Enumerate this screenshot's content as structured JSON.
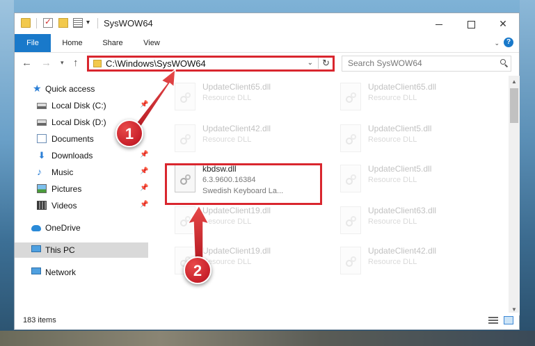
{
  "window": {
    "title": "SysWOW64"
  },
  "ribbon": {
    "tabs": [
      "File",
      "Home",
      "Share",
      "View"
    ]
  },
  "address": {
    "path": "C:\\Windows\\SysWOW64"
  },
  "search": {
    "placeholder": "Search SysWOW64"
  },
  "sidebar": {
    "items": [
      {
        "label": "Quick access",
        "icon": "star-icon"
      },
      {
        "label": "Local Disk (C:)",
        "icon": "drive-icon",
        "pinned": true
      },
      {
        "label": "Local Disk (D:)",
        "icon": "drive-icon",
        "pinned": false
      },
      {
        "label": "Documents",
        "icon": "documents-icon",
        "pinned": false
      },
      {
        "label": "Downloads",
        "icon": "download-icon",
        "pinned": true
      },
      {
        "label": "Music",
        "icon": "music-icon",
        "pinned": true
      },
      {
        "label": "Pictures",
        "icon": "pictures-icon",
        "pinned": true
      },
      {
        "label": "Videos",
        "icon": "videos-icon",
        "pinned": true
      },
      {
        "label": "OneDrive",
        "icon": "cloud-icon"
      },
      {
        "label": "This PC",
        "icon": "computer-icon",
        "selected": true
      },
      {
        "label": "Network",
        "icon": "network-icon"
      }
    ]
  },
  "files": [
    {
      "name": "UpdateClient65.dll",
      "type": "Resource DLL",
      "faded": true
    },
    {
      "name": "UpdateClient65.dll",
      "type": "Resource DLL",
      "faded": true
    },
    {
      "name": "UpdateClient42.dll",
      "type": "Resource DLL",
      "faded": true
    },
    {
      "name": "UpdateClient5.dll",
      "type": "Resource DLL",
      "faded": true
    },
    {
      "name": "kbdsw.dll",
      "version": "6.3.9600.16384",
      "description": "Swedish Keyboard La...",
      "faded": false,
      "highlighted": true
    },
    {
      "name": "UpdateClient5.dll",
      "type": "Resource DLL",
      "faded": true
    },
    {
      "name": "UpdateClient19.dll",
      "type": "Resource DLL",
      "faded": true
    },
    {
      "name": "UpdateClient63.dll",
      "type": "Resource DLL",
      "faded": true
    },
    {
      "name": "UpdateClient19.dll",
      "type": "Resource DLL",
      "faded": true
    },
    {
      "name": "UpdateClient42.dll",
      "type": "Resource DLL",
      "faded": true
    }
  ],
  "status": {
    "item_count": "183 items"
  },
  "annotations": {
    "step1": "1",
    "step2": "2",
    "color": "#d9262e"
  },
  "colors": {
    "accent": "#1979ca",
    "highlight": "#d9262e"
  }
}
